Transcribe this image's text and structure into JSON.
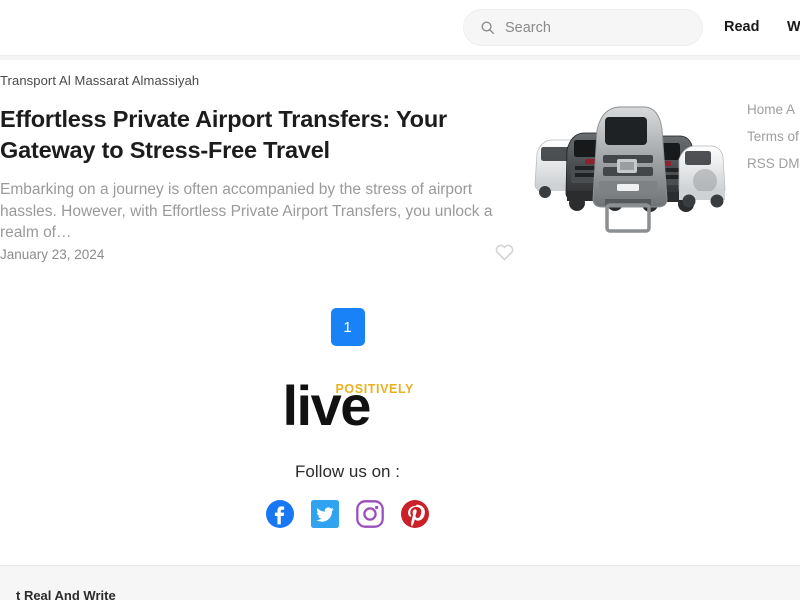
{
  "header": {
    "search": {
      "placeholder": "Search",
      "value": "",
      "icon": "search-icon"
    },
    "nav": {
      "read_label": "Read",
      "write_label": "W"
    }
  },
  "article": {
    "source": "Transport Al Massarat Almassiyah",
    "title": "Effortless Private Airport Transfers: Your Gateway to Stress-Free Travel",
    "excerpt": "Embarking on a journey is often accompanied by the stress of airport hassles. However, with Effortless Private Airport Transfers, you unlock a realm of…",
    "date": "January 23, 2024",
    "like_icon": "heart-icon",
    "thumbnail_alt": "fleet-of-vans-image"
  },
  "side_links": {
    "row1": "Home  A",
    "row2": "Terms of ",
    "row3": "RSS  DM"
  },
  "pagination": {
    "current_page": "1"
  },
  "footer": {
    "logo": {
      "word_mark": "live",
      "tagline": "POSITIVELY",
      "tagline_color": "#e9b11f"
    },
    "follow_label": "Follow us on :",
    "socials": [
      {
        "name": "facebook-icon",
        "color": "#1877F2"
      },
      {
        "name": "twitter-icon",
        "color": "#2FA3EF"
      },
      {
        "name": "instagram-icon",
        "color": "#9B4FBD"
      },
      {
        "name": "pinterest-icon",
        "color": "#CB2027"
      }
    ],
    "bottom_text": "t Real And Write"
  },
  "colors": {
    "accent": "#1a82f7",
    "brand_gold": "#e9b11f",
    "text": "#1c1c1c",
    "muted": "#9a9a9a"
  }
}
